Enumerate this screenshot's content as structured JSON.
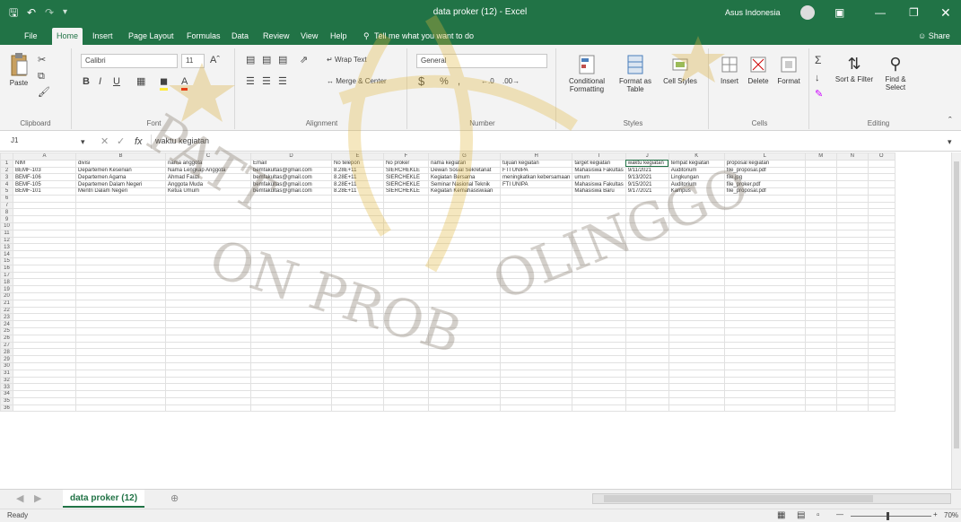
{
  "window": {
    "title": "data proker (12) - Excel",
    "user": "Asus Indonesia"
  },
  "quick_access": {
    "save": "save-icon",
    "undo": "undo-icon",
    "redo": "redo-icon"
  },
  "tabs": [
    {
      "label": "File"
    },
    {
      "label": "Home"
    },
    {
      "label": "Insert"
    },
    {
      "label": "Page Layout"
    },
    {
      "label": "Formulas"
    },
    {
      "label": "Data"
    },
    {
      "label": "Review"
    },
    {
      "label": "View"
    },
    {
      "label": "Help"
    }
  ],
  "tell_me": "Tell me what you want to do",
  "share": "Share",
  "ribbon": {
    "clipboard": {
      "label": "Clipboard",
      "paste": "Paste"
    },
    "font": {
      "label": "Font",
      "name": "Calibri",
      "size": "11",
      "bold": "B",
      "italic": "I",
      "underline": "U"
    },
    "alignment": {
      "label": "Alignment",
      "wrap": "Wrap Text",
      "merge": "Merge & Center"
    },
    "number": {
      "label": "Number",
      "format": "General",
      "currency": "$",
      "percent": "%",
      "comma": ","
    },
    "styles": {
      "label": "Styles",
      "conditional": "Conditional Formatting",
      "table": "Format as Table",
      "cell": "Cell Styles"
    },
    "cells": {
      "label": "Cells",
      "insert": "Insert",
      "delete": "Delete",
      "format": "Format"
    },
    "editing": {
      "label": "Editing",
      "sum": "Σ",
      "sort": "Sort & Filter",
      "find": "Find & Select"
    }
  },
  "formula_bar": {
    "name_box": "J1",
    "fx": "fx",
    "value": "waktu kegiatan"
  },
  "grid": {
    "columns": [
      "A",
      "B",
      "C",
      "D",
      "E",
      "F",
      "G",
      "H",
      "I",
      "J",
      "K",
      "L",
      "M",
      "N",
      "O"
    ],
    "header_row": [
      "NIM",
      "divisi",
      "nama anggota",
      "Email",
      "No telepon",
      "No proker",
      "nama kegiatan",
      "tujuan kegiatan",
      "target kegiatan",
      "waktu kegiatan",
      "tempat kegiatan",
      "proposal kegiatan",
      "",
      "",
      ""
    ],
    "rows": [
      [
        "BEMF-103",
        "Departemen Kesenian",
        "Nama Lengkap Anggota",
        "bemfakultas@gmail.com",
        "8.28E+11",
        "SIERCHEKLE",
        "Dewan Sosial Sekretariat",
        "FTI UNIPA",
        "Mahasiswa Fakultas",
        "9/11/2021",
        "Auditorium",
        "file_proposal.pdf",
        "",
        "",
        ""
      ],
      [
        "BEMF-106",
        "Departemen Agama",
        "Ahmad Fauzi",
        "bemfakultas@gmail.com",
        "8.28E+11",
        "SIERCHEKLE",
        "Kegiatan Bersama",
        "meningkatkan kebersamaan",
        "umum",
        "9/13/2021",
        "Lingkungan",
        "file.jpg",
        "",
        "",
        ""
      ],
      [
        "BEMF-105",
        "Departemen Dalam Negeri",
        "Anggota Muda",
        "bemfakultas@gmail.com",
        "8.28E+11",
        "SIERCHEKLE",
        "Seminar Nasional Teknik",
        "FTI UNIPA",
        "Mahasiswa Fakultas",
        "9/15/2021",
        "Auditorium",
        "file_proker.pdf",
        "",
        "",
        ""
      ],
      [
        "BEMF-101",
        "Mentri Dalam Negeri",
        "Ketua Umum",
        "bemfakultas@gmail.com",
        "8.28E+11",
        "SIERCHEKLE",
        "Kegiatan Kemahasiswaan",
        "",
        "Mahasiswa Baru",
        "9/17/2021",
        "Kampus",
        "file_proposal.pdf",
        "",
        "",
        ""
      ]
    ],
    "empty_rows": 31
  },
  "sheet_tabs": [
    {
      "label": "data proker (12)"
    }
  ],
  "status": {
    "ready": "Ready",
    "zoom": "70%"
  },
  "watermark": {
    "text": "PATTON PROBOLINGGO"
  },
  "colors": {
    "accent": "#217346",
    "watermark": "#e9c44f"
  }
}
